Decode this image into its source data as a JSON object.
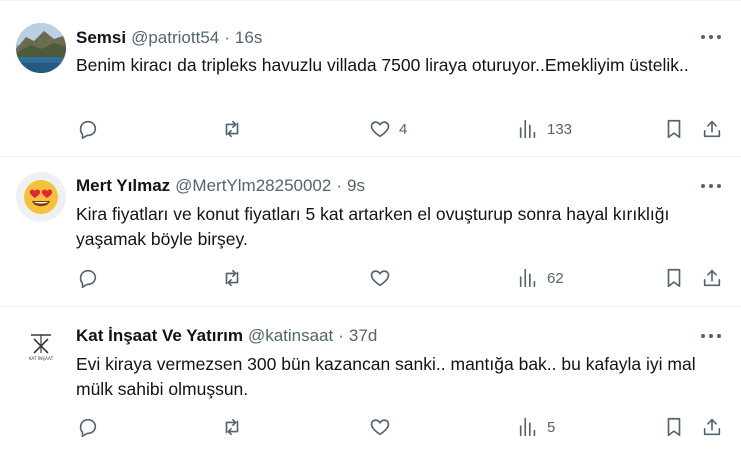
{
  "tweets": [
    {
      "name": "Semsi",
      "handle": "@patriott54",
      "time": "16s",
      "text": "Benim kiracı da tripleks havuzlu villada 7500 liraya oturuyor..Emekliyim üstelik..",
      "likes": "4",
      "views": "133",
      "avatar": "landscape-photo"
    },
    {
      "name": "Mert Yılmaz",
      "handle": "@MertYlm28250002",
      "time": "9s",
      "text": "Kira fiyatları ve konut fiyatları 5 kat artarken el ovuşturup sonra hayal kırıklığı yaşamak böyle birşey.",
      "likes": "",
      "views": "62",
      "avatar": "heart-eyes-emoji"
    },
    {
      "name": "Kat İnşaat Ve Yatırım",
      "handle": "@katinsaat",
      "time": "37d",
      "text": "Evi kiraya vermezsen 300 bün kazancan sanki.. mantığa bak.. bu kafayla iyi mal mülk sahibi olmuşsun.",
      "likes": "",
      "views": "5",
      "avatar": "company-logo",
      "avatar_text": "KAT İNŞAAT"
    }
  ],
  "separator": "·",
  "colors": {
    "text": "#0f1419",
    "secondary": "#536471",
    "border": "#eff3f4"
  }
}
